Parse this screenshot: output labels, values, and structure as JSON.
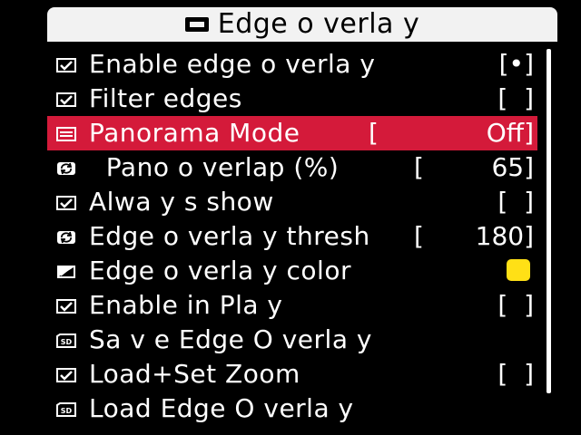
{
  "menu": {
    "title": "Edge o verla y",
    "items": [
      {
        "icon": "checkbox-icon",
        "label": "Enable edge o verla y",
        "value": "[•]"
      },
      {
        "icon": "checkbox-icon",
        "label": "Filter edges",
        "value": "[  ]"
      },
      {
        "icon": "list-icon",
        "label": "Panorama Mode",
        "lbracket": "[",
        "value": "Off]",
        "selected": true
      },
      {
        "icon": "cycle-icon",
        "label": "  Pano o verlap (%)",
        "lbracket": "[",
        "value": "65]"
      },
      {
        "icon": "checkbox-icon",
        "label": "Alwa y s show",
        "value": "[  ]"
      },
      {
        "icon": "cycle-icon",
        "label": "Edge o verla y thresh",
        "lbracket": "[",
        "value": "180]"
      },
      {
        "icon": "color-icon",
        "label": "Edge o verla y color",
        "swatch_color": "#ffe016"
      },
      {
        "icon": "checkbox-icon",
        "label": "Enable in Pla y",
        "value": "[  ]"
      },
      {
        "icon": "sd-card-icon",
        "label": "Sa v e Edge O verla y"
      },
      {
        "icon": "checkbox-icon",
        "label": "Load+Set Zoom",
        "value": "[  ]"
      },
      {
        "icon": "sd-card-icon",
        "label": "Load Edge O verla y"
      }
    ]
  },
  "colors": {
    "selected_row": "#d41a3a",
    "title_bar": "#f2f2f2",
    "swatch": "#ffe016"
  }
}
